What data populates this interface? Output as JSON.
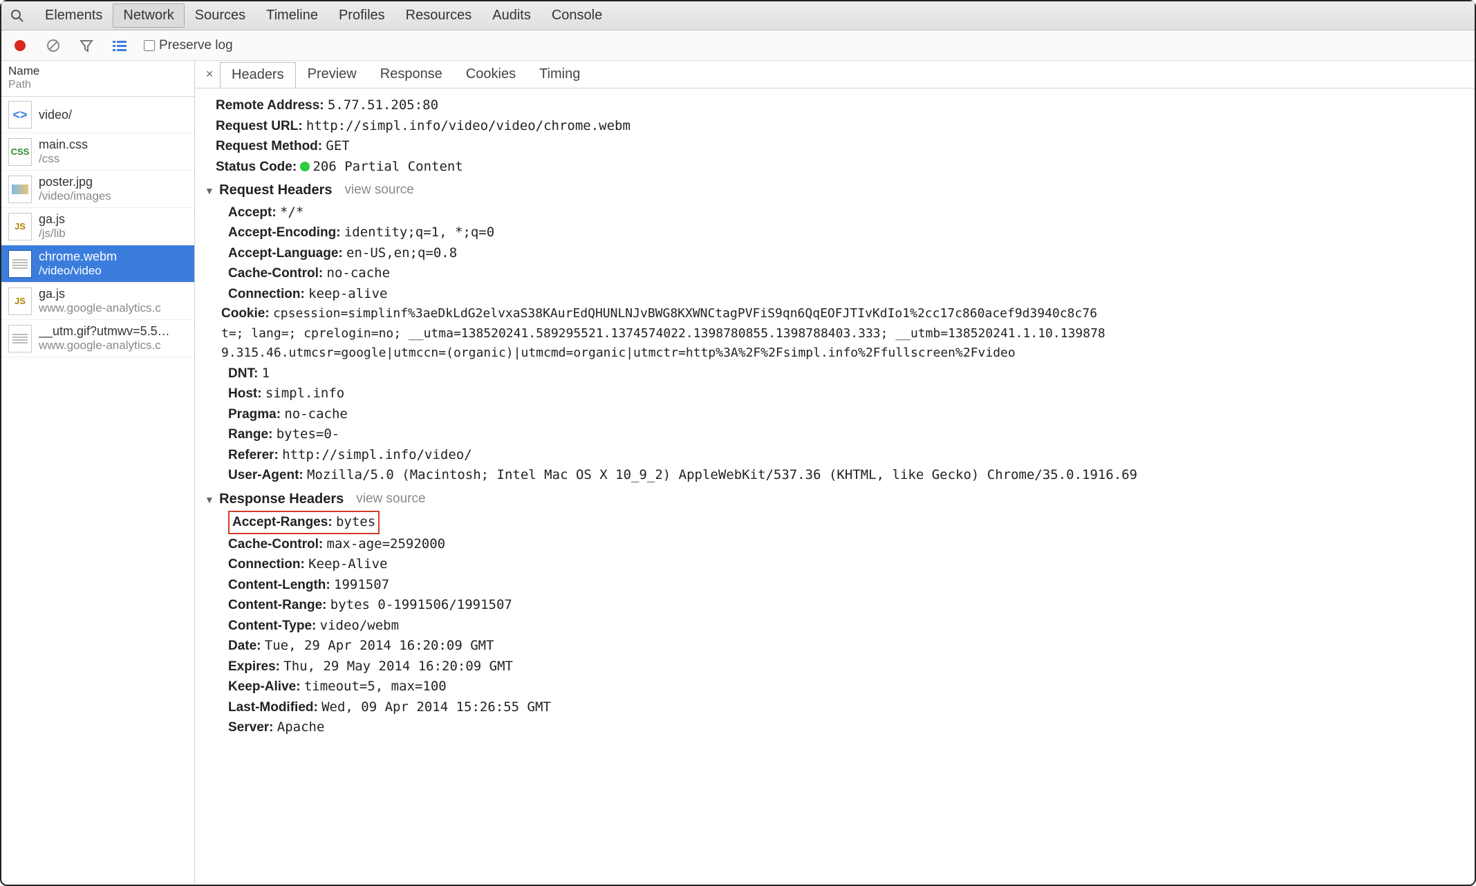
{
  "topTabs": {
    "items": [
      "Elements",
      "Network",
      "Sources",
      "Timeline",
      "Profiles",
      "Resources",
      "Audits",
      "Console"
    ],
    "activeIndex": 1
  },
  "toolbar": {
    "preserve_label": "Preserve log",
    "preserve_checked": false
  },
  "sidebar": {
    "header_name": "Name",
    "header_path": "Path",
    "items": [
      {
        "type": "html",
        "name": "video/",
        "path": ""
      },
      {
        "type": "css",
        "name": "main.css",
        "path": "/css"
      },
      {
        "type": "img",
        "name": "poster.jpg",
        "path": "/video/images"
      },
      {
        "type": "js",
        "name": "ga.js",
        "path": "/js/lib"
      },
      {
        "type": "doc",
        "name": "chrome.webm",
        "path": "/video/video",
        "selected": true
      },
      {
        "type": "js",
        "name": "ga.js",
        "path": "www.google-analytics.c"
      },
      {
        "type": "doc",
        "name": "__utm.gif?utmwv=5.5…",
        "path": "www.google-analytics.c"
      }
    ]
  },
  "detailTabs": {
    "items": [
      "Headers",
      "Preview",
      "Response",
      "Cookies",
      "Timing"
    ],
    "activeIndex": 0
  },
  "general": {
    "remote_address_k": "Remote Address:",
    "remote_address_v": "5.77.51.205:80",
    "request_url_k": "Request URL:",
    "request_url_v": "http://simpl.info/video/video/chrome.webm",
    "request_method_k": "Request Method:",
    "request_method_v": "GET",
    "status_code_k": "Status Code:",
    "status_code_v": "206 Partial Content"
  },
  "sections": {
    "request_headers_label": "Request Headers",
    "response_headers_label": "Response Headers",
    "view_source": "view source"
  },
  "request_headers": [
    {
      "k": "Accept:",
      "v": "*/*"
    },
    {
      "k": "Accept-Encoding:",
      "v": "identity;q=1, *;q=0"
    },
    {
      "k": "Accept-Language:",
      "v": "en-US,en;q=0.8"
    },
    {
      "k": "Cache-Control:",
      "v": "no-cache"
    },
    {
      "k": "Connection:",
      "v": "keep-alive"
    }
  ],
  "cookie": {
    "k": "Cookie:",
    "line1": "cpsession=simplinf%3aeDkLdG2elvxaS38KAurEdQHUNLNJvBWG8KXWNCtagPVFiS9qn6QqEOFJTIvKdIo1%2cc17c860acef9d3940c8c76",
    "line2": "t=; lang=; cprelogin=no; __utma=138520241.589295521.1374574022.1398780855.1398788403.333; __utmb=138520241.1.10.139878",
    "line3": "9.315.46.utmcsr=google|utmccn=(organic)|utmcmd=organic|utmctr=http%3A%2F%2Fsimpl.info%2Ffullscreen%2Fvideo"
  },
  "request_headers_tail": [
    {
      "k": "DNT:",
      "v": "1"
    },
    {
      "k": "Host:",
      "v": "simpl.info"
    },
    {
      "k": "Pragma:",
      "v": "no-cache"
    },
    {
      "k": "Range:",
      "v": "bytes=0-"
    },
    {
      "k": "Referer:",
      "v": "http://simpl.info/video/"
    },
    {
      "k": "User-Agent:",
      "v": "Mozilla/5.0 (Macintosh; Intel Mac OS X 10_9_2) AppleWebKit/537.36 (KHTML, like Gecko) Chrome/35.0.1916.69"
    }
  ],
  "response_headers": [
    {
      "k": "Accept-Ranges:",
      "v": "bytes",
      "highlight": true
    },
    {
      "k": "Cache-Control:",
      "v": "max-age=2592000"
    },
    {
      "k": "Connection:",
      "v": "Keep-Alive"
    },
    {
      "k": "Content-Length:",
      "v": "1991507"
    },
    {
      "k": "Content-Range:",
      "v": "bytes 0-1991506/1991507"
    },
    {
      "k": "Content-Type:",
      "v": "video/webm"
    },
    {
      "k": "Date:",
      "v": "Tue, 29 Apr 2014 16:20:09 GMT"
    },
    {
      "k": "Expires:",
      "v": "Thu, 29 May 2014 16:20:09 GMT"
    },
    {
      "k": "Keep-Alive:",
      "v": "timeout=5, max=100"
    },
    {
      "k": "Last-Modified:",
      "v": "Wed, 09 Apr 2014 15:26:55 GMT"
    },
    {
      "k": "Server:",
      "v": "Apache"
    }
  ]
}
